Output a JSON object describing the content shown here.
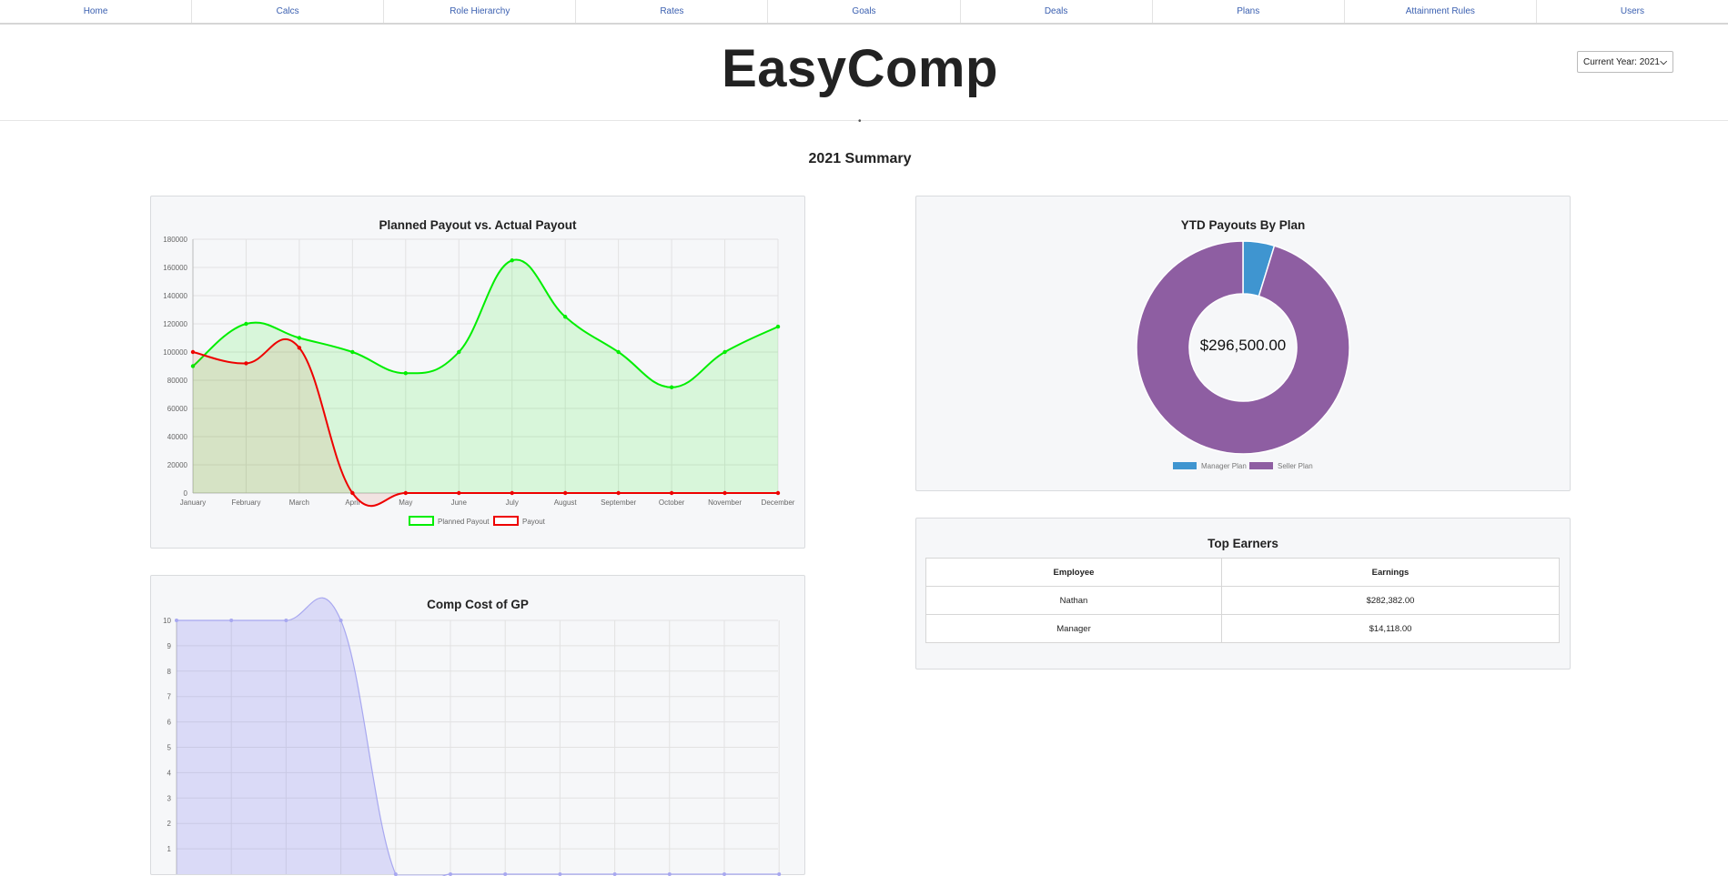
{
  "nav": {
    "items": [
      "Home",
      "Calcs",
      "Role Hierarchy",
      "Rates",
      "Goals",
      "Deals",
      "Plans",
      "Attainment Rules",
      "Users"
    ]
  },
  "header": {
    "title": "EasyComp",
    "year_select": "Current Year: 2021",
    "divider_mark": "•"
  },
  "summary_title": "2021 Summary",
  "colors": {
    "planned": "#00ee00",
    "payout": "#ee0000",
    "manager_plan": "#3f95d0",
    "seller_plan": "#8e5ea2",
    "comp_cost": "#a8a8f0",
    "nav_link": "#3a5fb0"
  },
  "chart_data": [
    {
      "id": "payout_chart",
      "type": "line",
      "title": "Planned Payout vs. Actual Payout",
      "categories": [
        "January",
        "February",
        "March",
        "April",
        "May",
        "June",
        "July",
        "August",
        "September",
        "October",
        "November",
        "December"
      ],
      "ylim": [
        0,
        180000
      ],
      "yticks": [
        0,
        20000,
        40000,
        60000,
        80000,
        100000,
        120000,
        140000,
        160000,
        180000
      ],
      "grid": true,
      "legend": "bottom",
      "series": [
        {
          "name": "Planned Payout",
          "values": [
            90000,
            120000,
            110000,
            100000,
            85000,
            100000,
            165000,
            125000,
            100000,
            75000,
            100000,
            118000
          ]
        },
        {
          "name": "Payout",
          "values": [
            100000,
            92000,
            103000,
            0,
            0,
            0,
            0,
            0,
            0,
            0,
            0,
            0
          ]
        }
      ]
    },
    {
      "id": "plan_donut",
      "type": "pie",
      "title": "YTD Payouts By Plan",
      "center_label": "$296,500.00",
      "legend": "bottom",
      "labels": [
        "Manager Plan",
        "Seller Plan"
      ],
      "values": [
        14118,
        282382
      ]
    },
    {
      "id": "comp_cost_chart",
      "type": "area",
      "title": "Comp Cost of GP",
      "x_count": 12,
      "values": [
        10,
        10,
        10,
        10,
        0,
        0,
        0,
        0,
        0,
        0,
        0,
        0
      ],
      "ylim": [
        0,
        10
      ],
      "yticks": [
        1,
        2,
        3,
        4,
        5,
        6,
        7,
        8,
        9,
        10
      ],
      "grid": true
    }
  ],
  "top_earners": {
    "title": "Top Earners",
    "columns": [
      "Employee",
      "Earnings"
    ],
    "rows": [
      [
        "Nathan",
        "$282,382.00"
      ],
      [
        "Manager",
        "$14,118.00"
      ]
    ]
  }
}
